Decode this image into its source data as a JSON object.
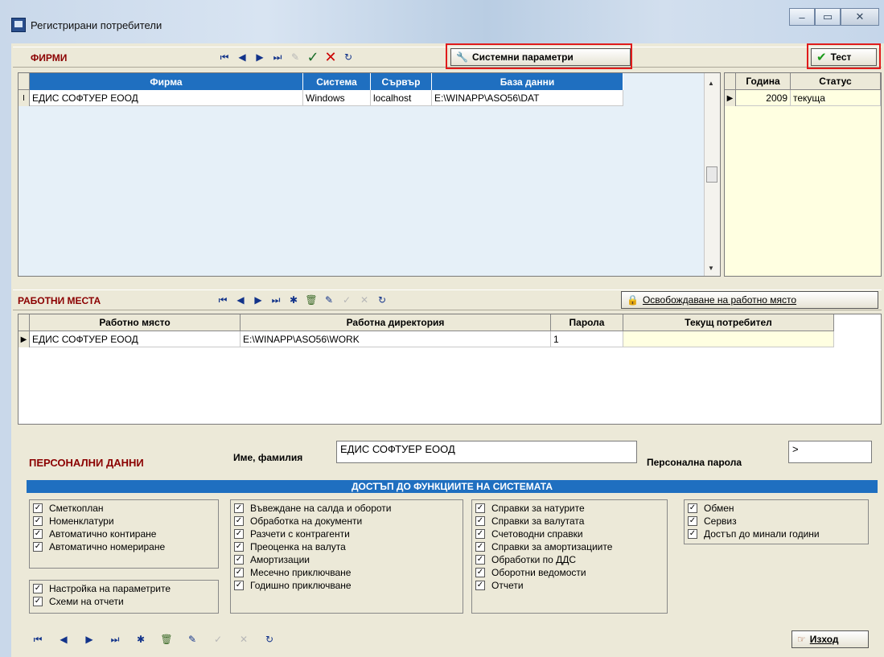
{
  "window": {
    "title": "Регистрирани потребители",
    "controls": [
      "–",
      "▭",
      "✕"
    ]
  },
  "firms": {
    "label": "ФИРМИ",
    "sys_params_button": "Системни параметри",
    "test_button": "Тест",
    "columns": [
      "Фирма",
      "Система",
      "Сървър",
      "База данни"
    ],
    "rows": [
      {
        "firm": "ЕДИС СОФТУЕР ЕООД",
        "system": "Windows",
        "server": "localhost",
        "db": "E:\\WINAPP\\ASO56\\DAT"
      }
    ],
    "year_columns": [
      "Година",
      "Статус"
    ],
    "year_rows": [
      {
        "year": "2009",
        "status": "текуща"
      }
    ]
  },
  "workplaces": {
    "label": "РАБОТНИ МЕСТА",
    "release_button": "Освобождаване на работно място",
    "columns": [
      "Работно място",
      "Работна директория",
      "Парола",
      "Текущ потребител"
    ],
    "rows": [
      {
        "place": "ЕДИС СОФТУЕР ЕООД",
        "dir": "E:\\WINAPP\\ASO56\\WORK",
        "password": "1",
        "user": ""
      }
    ]
  },
  "personal": {
    "label": "ПЕРСОНАЛНИ ДАННИ",
    "name_label": "Име, фамилия",
    "name_value": "ЕДИС СОФТУЕР ЕООД",
    "pass_label": "Персонална парола",
    "pass_value": ">"
  },
  "access": {
    "title": "ДОСТЪП ДО ФУНКЦИИТЕ НА СИСТЕМАТА",
    "g1": [
      "Сметкоплан",
      "Номенклатури",
      "Автоматично контиране",
      "Автоматично номериране"
    ],
    "g1b": [
      "Настройка на параметрите",
      "Схеми на отчети"
    ],
    "g2": [
      "Въвеждане на салда и обороти",
      "Обработка на документи",
      "Разчети с контрагенти",
      "Преоценка на валута",
      "Амортизации",
      "Месечно приключване",
      "Годишно приключване"
    ],
    "g3": [
      "Справки за натурите",
      "Справки за валутата",
      "Счетоводни справки",
      "Справки за амортизациите",
      "Обработки по ДДС",
      "Оборотни ведомости",
      "Отчети"
    ],
    "g4": [
      "Обмен",
      "Сервиз",
      "Достъп до минали години"
    ]
  },
  "footer": {
    "exit_button": "Изход"
  },
  "colors": {
    "grid_header": "#1f6fc0",
    "section_red": "#8b0000",
    "highlight_box": "#e01b1b",
    "year_panel": "#ffffe1"
  }
}
